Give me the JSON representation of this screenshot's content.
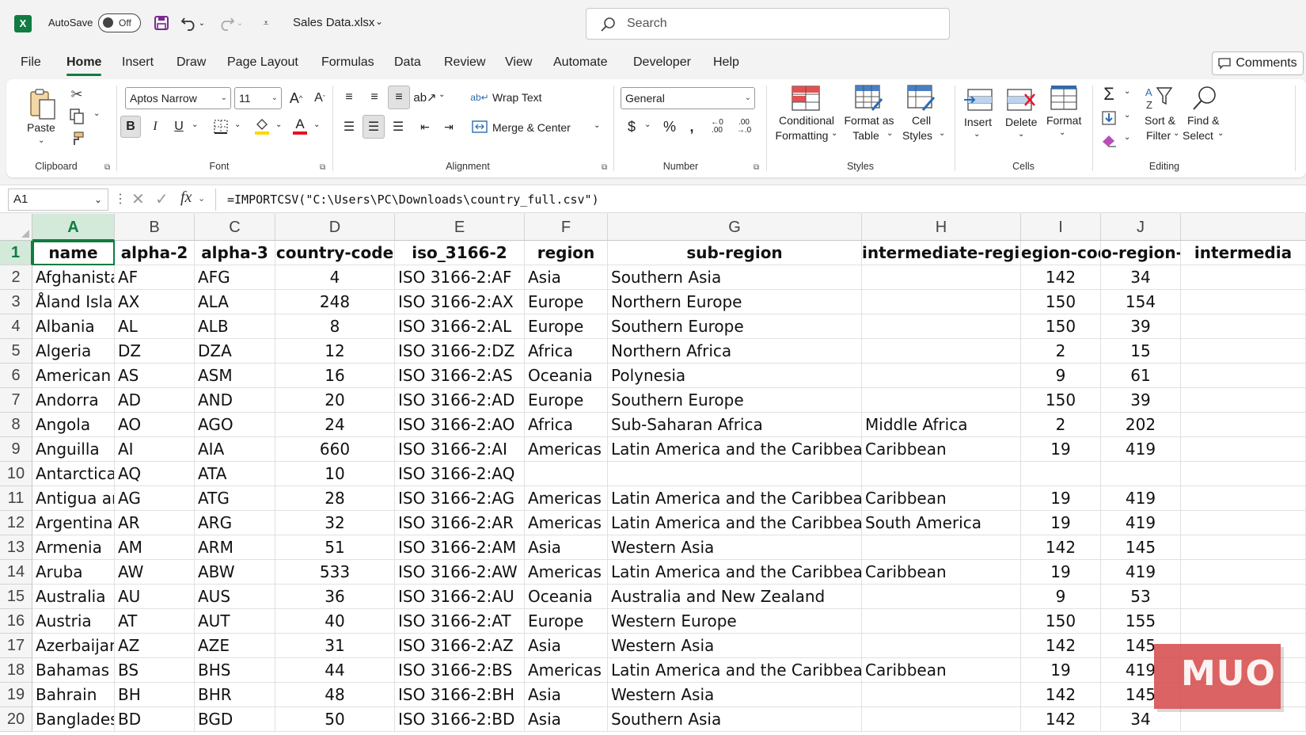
{
  "titlebar": {
    "app_icon": "X",
    "autosave_label": "AutoSave",
    "autosave_state": "Off",
    "filename": "Sales Data.xlsx",
    "search_placeholder": "Search"
  },
  "menu": {
    "items": [
      "File",
      "Home",
      "Insert",
      "Draw",
      "Page Layout",
      "Formulas",
      "Data",
      "Review",
      "View",
      "Automate",
      "Developer",
      "Help"
    ],
    "active": "Home",
    "comments_label": "Comments"
  },
  "ribbon": {
    "clipboard": {
      "paste": "Paste",
      "label": "Clipboard"
    },
    "font": {
      "family": "Aptos Narrow",
      "size": "11",
      "label": "Font"
    },
    "alignment": {
      "wrap_text": "Wrap Text",
      "merge_center": "Merge & Center",
      "label": "Alignment"
    },
    "number": {
      "format": "General",
      "label": "Number"
    },
    "styles": {
      "conditional_1": "Conditional",
      "conditional_2": "Formatting",
      "format_table_1": "Format as",
      "format_table_2": "Table",
      "cell_styles_1": "Cell",
      "cell_styles_2": "Styles",
      "label": "Styles"
    },
    "cells": {
      "insert": "Insert",
      "delete": "Delete",
      "format": "Format",
      "label": "Cells"
    },
    "editing": {
      "sort_1": "Sort &",
      "sort_2": "Filter",
      "find_1": "Find &",
      "find_2": "Select",
      "label": "Editing"
    }
  },
  "formula_bar": {
    "name_box": "A1",
    "formula": "=IMPORTCSV(\"C:\\Users\\PC\\Downloads\\country_full.csv\")"
  },
  "sheet": {
    "columns": [
      "A",
      "B",
      "C",
      "D",
      "E",
      "F",
      "G",
      "H",
      "I",
      "J"
    ],
    "selected_column": "A",
    "header_row": [
      "name",
      "alpha-2",
      "alpha-3",
      "country-code",
      "iso_3166-2",
      "region",
      "sub-region",
      "intermediate-region",
      "egion-code",
      "o-region-c",
      "intermedia"
    ],
    "rows": [
      [
        "Afghanista",
        "AF",
        "AFG",
        "4",
        "ISO 3166-2:AF",
        "Asia",
        "Southern Asia",
        "",
        "142",
        "34"
      ],
      [
        "Åland Islan",
        "AX",
        "ALA",
        "248",
        "ISO 3166-2:AX",
        "Europe",
        "Northern Europe",
        "",
        "150",
        "154"
      ],
      [
        "Albania",
        "AL",
        "ALB",
        "8",
        "ISO 3166-2:AL",
        "Europe",
        "Southern Europe",
        "",
        "150",
        "39"
      ],
      [
        "Algeria",
        "DZ",
        "DZA",
        "12",
        "ISO 3166-2:DZ",
        "Africa",
        "Northern Africa",
        "",
        "2",
        "15"
      ],
      [
        "American S",
        "AS",
        "ASM",
        "16",
        "ISO 3166-2:AS",
        "Oceania",
        "Polynesia",
        "",
        "9",
        "61"
      ],
      [
        "Andorra",
        "AD",
        "AND",
        "20",
        "ISO 3166-2:AD",
        "Europe",
        "Southern Europe",
        "",
        "150",
        "39"
      ],
      [
        "Angola",
        "AO",
        "AGO",
        "24",
        "ISO 3166-2:AO",
        "Africa",
        "Sub-Saharan Africa",
        "Middle Africa",
        "2",
        "202"
      ],
      [
        "Anguilla",
        "AI",
        "AIA",
        "660",
        "ISO 3166-2:AI",
        "Americas",
        "Latin America and the Caribbean",
        "Caribbean",
        "19",
        "419"
      ],
      [
        "Antarctica",
        "AQ",
        "ATA",
        "10",
        "ISO 3166-2:AQ",
        "",
        "",
        "",
        "",
        ""
      ],
      [
        "Antigua an",
        "AG",
        "ATG",
        "28",
        "ISO 3166-2:AG",
        "Americas",
        "Latin America and the Caribbean",
        "Caribbean",
        "19",
        "419"
      ],
      [
        "Argentina",
        "AR",
        "ARG",
        "32",
        "ISO 3166-2:AR",
        "Americas",
        "Latin America and the Caribbean",
        "South America",
        "19",
        "419"
      ],
      [
        "Armenia",
        "AM",
        "ARM",
        "51",
        "ISO 3166-2:AM",
        "Asia",
        "Western Asia",
        "",
        "142",
        "145"
      ],
      [
        "Aruba",
        "AW",
        "ABW",
        "533",
        "ISO 3166-2:AW",
        "Americas",
        "Latin America and the Caribbean",
        "Caribbean",
        "19",
        "419"
      ],
      [
        "Australia",
        "AU",
        "AUS",
        "36",
        "ISO 3166-2:AU",
        "Oceania",
        "Australia and New Zealand",
        "",
        "9",
        "53"
      ],
      [
        "Austria",
        "AT",
        "AUT",
        "40",
        "ISO 3166-2:AT",
        "Europe",
        "Western Europe",
        "",
        "150",
        "155"
      ],
      [
        "Azerbaijan",
        "AZ",
        "AZE",
        "31",
        "ISO 3166-2:AZ",
        "Asia",
        "Western Asia",
        "",
        "142",
        "145"
      ],
      [
        "Bahamas",
        "BS",
        "BHS",
        "44",
        "ISO 3166-2:BS",
        "Americas",
        "Latin America and the Caribbean",
        "Caribbean",
        "19",
        "419"
      ],
      [
        "Bahrain",
        "BH",
        "BHR",
        "48",
        "ISO 3166-2:BH",
        "Asia",
        "Western Asia",
        "",
        "142",
        "145"
      ],
      [
        "Banglades",
        "BD",
        "BGD",
        "50",
        "ISO 3166-2:BD",
        "Asia",
        "Southern Asia",
        "",
        "142",
        "34"
      ]
    ]
  },
  "watermark": "MUO",
  "colors": {
    "excel_green": "#107c41",
    "selection_bg": "#d3e9da",
    "watermark": "#d64848"
  }
}
